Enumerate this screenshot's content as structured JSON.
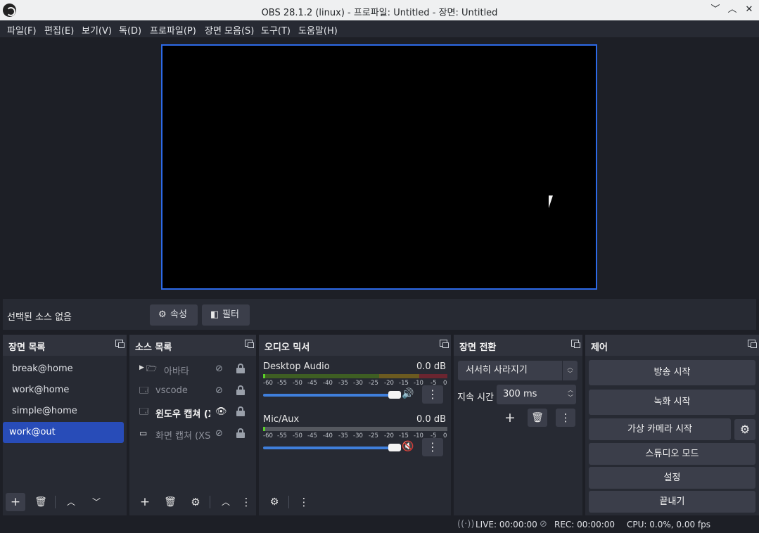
{
  "window": {
    "title": "OBS 28.1.2 (linux) - 프로파일: Untitled - 장면: Untitled",
    "minimize": "﹀",
    "maximize": "︿",
    "close": "✕"
  },
  "menu": [
    "파일(F)",
    "편집(E)",
    "보기(V)",
    "독(D)",
    "프로파일(P)",
    "장면 모음(S)",
    "도구(T)",
    "도움말(H)"
  ],
  "context": {
    "no_source": "선택된 소스 없음",
    "properties": "속성",
    "filters": "필터"
  },
  "scenes": {
    "title": "장면 목록",
    "items": [
      "break@home",
      "work@home",
      "simple@home",
      "work@out"
    ],
    "active": "work@out"
  },
  "sources": {
    "title": "소스 목록",
    "items": [
      {
        "name": "아바타",
        "type": "group",
        "visible": false
      },
      {
        "name": "vscode",
        "type": "window",
        "visible": false
      },
      {
        "name": "윈도우 캡쳐 (X",
        "type": "window",
        "visible": true
      },
      {
        "name": "화면 캡쳐 (XSh",
        "type": "display",
        "visible": false
      }
    ]
  },
  "mixer": {
    "title": "오디오 믹서",
    "channels": [
      {
        "name": "Desktop Audio",
        "db": "0.0 dB",
        "muted": false
      },
      {
        "name": "Mic/Aux",
        "db": "0.0 dB",
        "muted": true
      }
    ],
    "scale": [
      "-60",
      "-55",
      "-50",
      "-45",
      "-40",
      "-35",
      "-30",
      "-25",
      "-20",
      "-15",
      "-10",
      "-5",
      "0"
    ]
  },
  "transitions": {
    "title": "장면 전환",
    "selected": "서서히 사라지기",
    "duration_label": "지속 시간",
    "duration": "300 ms"
  },
  "controls": {
    "title": "제어",
    "stream": "방송 시작",
    "record": "녹화 시작",
    "virtualcam": "가상 카메라 시작",
    "studio": "스튜디오 모드",
    "settings": "설정",
    "exit": "끝내기"
  },
  "status": {
    "live": "LIVE: 00:00:00",
    "rec": "REC: 00:00:00",
    "cpu": "CPU: 0.0%, 0.00 fps"
  },
  "colors": {
    "accent": "#2d6ae8",
    "active_scene": "#284cb8",
    "muted": "#d23a3a"
  }
}
